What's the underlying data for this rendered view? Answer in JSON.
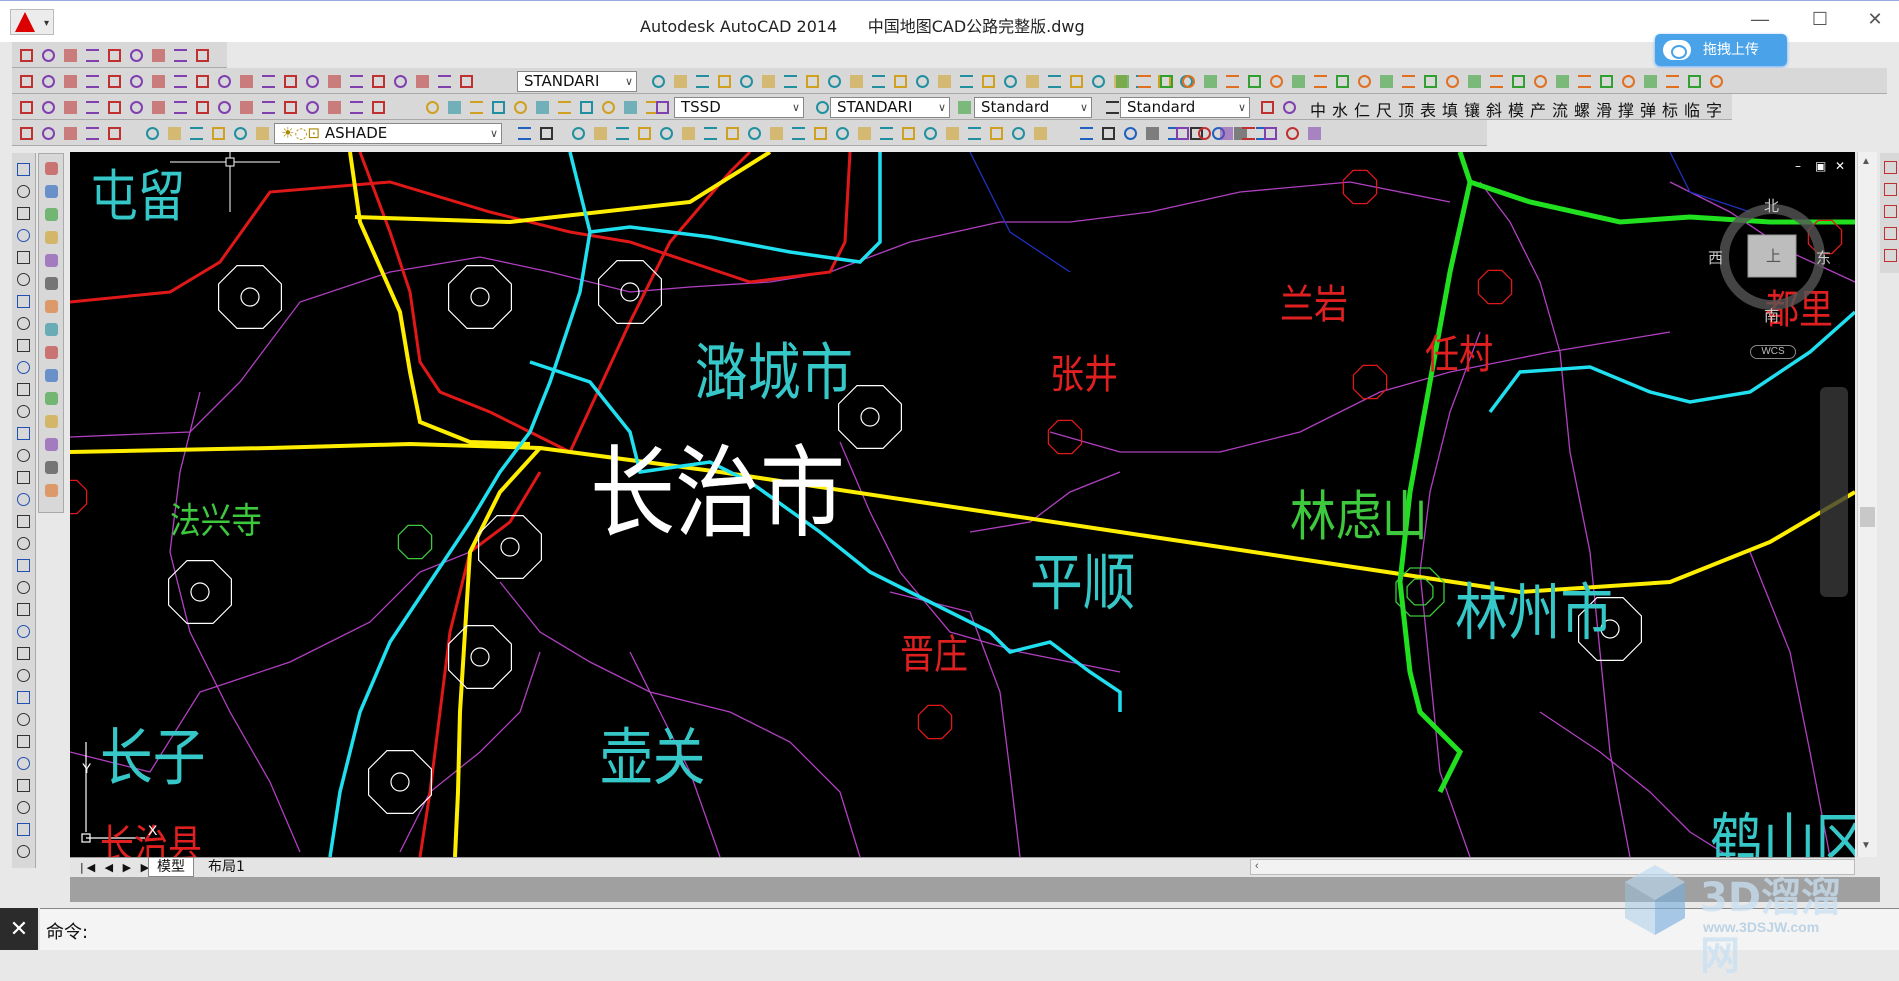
{
  "title": "Autodesk AutoCAD 2014      中国地图CAD公路完整版.dwg",
  "baidu_upload": "拖拽上传",
  "toolbar1": {
    "text_style": "STANDARI"
  },
  "toolbar2": {
    "cn_buttons": [
      "中",
      "水",
      "仁",
      "尺",
      "顶",
      "表",
      "填",
      "镶",
      "斜",
      "模",
      "产",
      "流",
      "螺",
      "滑",
      "撑",
      "弹",
      "标",
      "临",
      "字"
    ]
  },
  "toolbar3": {
    "style_tssd": "TSSD",
    "dim_style": "STANDARI",
    "table_style": "Standard",
    "multileader_style": "Standard"
  },
  "toolbar4": {
    "layer": "ASHADE"
  },
  "viewcube": {
    "north": "北",
    "south": "南",
    "east": "东",
    "west": "西",
    "top_face": "上",
    "wcs": "WCS"
  },
  "map_labels": [
    {
      "text": "屯留",
      "color": "#36c8c8",
      "size": 56
    },
    {
      "text": "潞城市",
      "color": "#36c8c8",
      "size": 62
    },
    {
      "text": "张井",
      "color": "#e02020",
      "size": 40
    },
    {
      "text": "兰岩",
      "color": "#e02020",
      "size": 40
    },
    {
      "text": "任村",
      "color": "#e02020",
      "size": 40
    },
    {
      "text": "都里",
      "color": "#e02020",
      "size": 40
    },
    {
      "text": "法兴寺",
      "color": "#3ec83e",
      "size": 36
    },
    {
      "text": "长治市",
      "color": "#ffffff",
      "size": 100
    },
    {
      "text": "平顺",
      "color": "#36c8c8",
      "size": 62
    },
    {
      "text": "林虑山",
      "color": "#3ec83e",
      "size": 54
    },
    {
      "text": "林州市",
      "color": "#36c8c8",
      "size": 62
    },
    {
      "text": "晋庄",
      "color": "#e02020",
      "size": 40
    },
    {
      "text": "长子",
      "color": "#36c8c8",
      "size": 62
    },
    {
      "text": "壶关",
      "color": "#36c8c8",
      "size": 62
    },
    {
      "text": "鹤山区",
      "color": "#36c8c8",
      "size": 62
    },
    {
      "text": "长治县",
      "color": "#e02020",
      "size": 40
    }
  ],
  "ucs": {
    "y": "Y",
    "x": "X"
  },
  "layout_tabs": [
    "模型",
    "布局1"
  ],
  "command_prompt": "命令:",
  "watermark": {
    "brand": "3D溜溜网",
    "url": "www.3DSJW.com"
  }
}
